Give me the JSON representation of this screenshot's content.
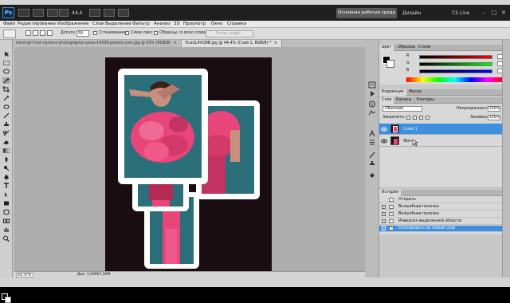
{
  "titlebar": {
    "logo": "Ps",
    "zoom_value": "44,4",
    "workspace_active": "Основная рабочая среда",
    "workspace_alt": "Дизайн",
    "cs_live": "CS Live",
    "window_controls": [
      "–",
      "□",
      "✕"
    ]
  },
  "menu": {
    "items": [
      "Файл",
      "Редактирование",
      "Изображение",
      "Слои",
      "Выделение",
      "Фильтр",
      "Анализ",
      "3D",
      "Просмотр",
      "Окно",
      "Справка"
    ]
  },
  "options": {
    "tolerance_label": "Допуск:",
    "tolerance_value": "50",
    "antialias_label": "Сглаживание",
    "contiguous_label": "Смеж.пикс",
    "all_layers_label": "Образцы со всех слоев",
    "refine_label": "Уточн. край..."
  },
  "tabs": [
    {
      "label": "hand-girl-hair-camera-photographer-pose-14398-pxhere.com.jpg @ 50% (RGB/8)",
      "close": "×",
      "active": false
    },
    {
      "label": "YLie1L4VQ8B.jpg @ 44,4% (Слой 1, RGB/8) *",
      "close": "×",
      "active": true
    }
  ],
  "status": {
    "zoom": "44,37%",
    "doc": "Док: 3,54M/7,30M"
  },
  "color_panel": {
    "tabs": [
      "Цвет",
      "Образцы",
      "Стили"
    ],
    "sliders": [
      {
        "label": "R",
        "value": "",
        "gradient": "#ff0000"
      },
      {
        "label": "G",
        "value": "",
        "gradient": "#00ff00"
      },
      {
        "label": "B",
        "value": "",
        "gradient": "#0000ff"
      }
    ]
  },
  "adjust_panel": {
    "tabs": [
      "Коррекция",
      "Маски"
    ]
  },
  "layers_panel": {
    "tabs": [
      "Слои",
      "Каналы",
      "Контуры"
    ],
    "blend_mode": "Обычные",
    "opacity_label": "Непрозрачность:",
    "opacity_value": "100%",
    "lock_label": "Закрепить:",
    "fill_label": "Заливка:",
    "fill_value": "100%",
    "layers": [
      {
        "name": "Слой 1",
        "selected": true
      },
      {
        "name": "Фон",
        "selected": false
      }
    ]
  },
  "history_panel": {
    "tabs": [
      "История"
    ],
    "items": [
      {
        "label": "Открыть",
        "selected": false
      },
      {
        "label": "Волшебная палочка",
        "selected": false
      },
      {
        "label": "Волшебная палочка",
        "selected": false
      },
      {
        "label": "Инверсия выделенной области",
        "selected": false
      },
      {
        "label": "Скопировать на новый слой",
        "selected": true
      }
    ]
  },
  "colors": {
    "accent": "#3d8fe0",
    "document_bg": "#1a0d12",
    "photo_teal": "#2b6f7a",
    "dress_pink": "#e8457a"
  }
}
